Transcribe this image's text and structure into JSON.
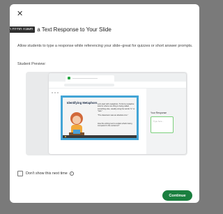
{
  "dialog": {
    "close_icon": "close-icon",
    "tooltip_text": "תשובה תחירת חשמל",
    "title": "a Text Response to Your Slide",
    "description": "Allow students to type a response while referencing your slide–great for quizzes or short answer prompts.",
    "preview_label": "Student Preview:"
  },
  "preview": {
    "slide_title": "Identifying Metaphors",
    "slide_text_1": "Let's start with metaphors. To find a metaphor, look for where one thing is being called something else, usually using the words \"is\" or \"was.\"",
    "slide_text_2": "\"The classroom was an absolute zoo.\"",
    "slide_text_3": "How the writing tool to explain what's being compared in the sentence?",
    "response_label": "Your Response",
    "response_placeholder": "Type here..."
  },
  "footer": {
    "checkbox_label": "Don't show this next time",
    "info_icon": "info-icon",
    "continue_label": "Continue"
  },
  "colors": {
    "accent": "#1a7f3f",
    "slide_border": "#43a5d6"
  }
}
